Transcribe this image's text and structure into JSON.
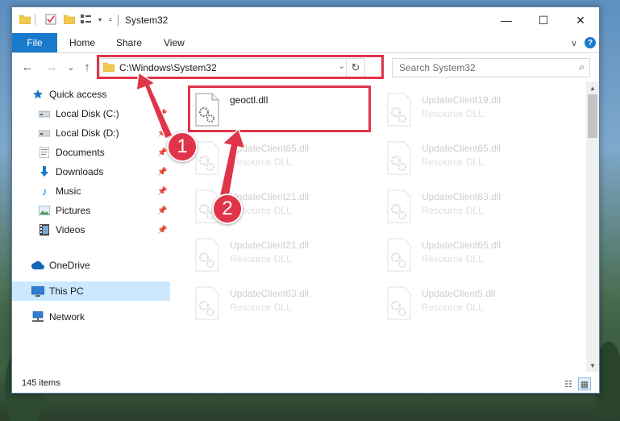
{
  "window": {
    "title": "System32",
    "minimize_glyph": "—",
    "maximize_glyph": "☐",
    "close_glyph": "✕"
  },
  "ribbon": {
    "tabs": [
      "File",
      "Home",
      "Share",
      "View"
    ],
    "expand_glyph": "∨",
    "help_glyph": "?"
  },
  "nav": {
    "back_glyph": "←",
    "forward_glyph": "→",
    "recent_glyph": "⌄",
    "up_glyph": "↑",
    "address_path": "C:\\Windows\\System32",
    "address_drop_glyph": "⌄",
    "refresh_glyph": "↻",
    "search_placeholder": "Search System32",
    "search_glyph": "⌕"
  },
  "sidebar": {
    "pin_glyph": "📌",
    "items": [
      {
        "label": "Quick access",
        "icon": "star-icon"
      },
      {
        "label": "Local Disk (C:)",
        "icon": "drive-icon"
      },
      {
        "label": "Local Disk (D:)",
        "icon": "drive-icon"
      },
      {
        "label": "Documents",
        "icon": "documents-icon"
      },
      {
        "label": "Downloads",
        "icon": "download-icon"
      },
      {
        "label": "Music",
        "icon": "music-icon"
      },
      {
        "label": "Pictures",
        "icon": "pictures-icon"
      },
      {
        "label": "Videos",
        "icon": "videos-icon"
      },
      {
        "label": "OneDrive",
        "icon": "cloud-icon"
      },
      {
        "label": "This PC",
        "icon": "computer-icon",
        "selected": true
      },
      {
        "label": "Network",
        "icon": "network-icon"
      }
    ]
  },
  "files": [
    {
      "name": "geoctl.dll",
      "type": "",
      "highlighted": true
    },
    {
      "name": "UpdateClient19.dll",
      "type": "Resource DLL"
    },
    {
      "name": "UpdateClient65.dll",
      "type": "Resource DLL"
    },
    {
      "name": "UpdateClient65.dll",
      "type": "Resource DLL"
    },
    {
      "name": "UpdateClient21.dll",
      "type": "Resource DLL"
    },
    {
      "name": "UpdateClient63.dll",
      "type": "Resource DLL"
    },
    {
      "name": "UpdateClient21.dll",
      "type": "Resource DLL"
    },
    {
      "name": "UpdateClient65.dll",
      "type": "Resource DLL"
    },
    {
      "name": "UpdateClient63.dll",
      "type": "Resource DLL"
    },
    {
      "name": "UpdateClient5.dll",
      "type": "Resource DLL"
    }
  ],
  "status": {
    "item_count": "145 items"
  },
  "callouts": [
    "1",
    "2"
  ],
  "colors": {
    "accent": "#1979ca",
    "highlight": "#e0344a",
    "selected_bg": "#cce8ff"
  }
}
